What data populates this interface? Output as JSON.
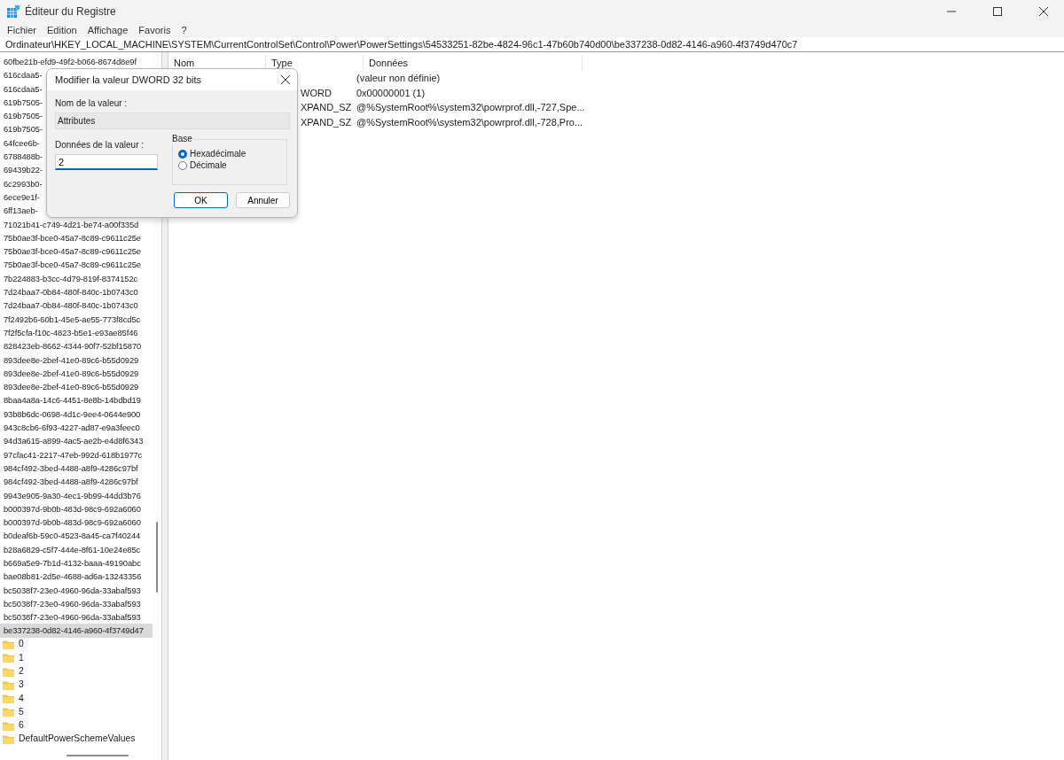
{
  "window": {
    "title": "Éditeur du Registre"
  },
  "menu": [
    "Fichier",
    "Edition",
    "Affichage",
    "Favoris",
    "?"
  ],
  "address": "Ordinateur\\HKEY_LOCAL_MACHINE\\SYSTEM\\CurrentControlSet\\Control\\Power\\PowerSettings\\54533251-82be-4824-96c1-47b60b740d00\\be337238-0d82-4146-a960-4f3749d470c7",
  "tree": [
    {
      "label": "60fbe21b-efd9-49f2-b066-8674d8e9f",
      "selected": false
    },
    {
      "label": "616cdaa5-",
      "selected": false
    },
    {
      "label": "616cdaa5-",
      "selected": false
    },
    {
      "label": "619b7505-",
      "selected": false
    },
    {
      "label": "619b7505-",
      "selected": false
    },
    {
      "label": "619b7505-",
      "selected": false
    },
    {
      "label": "64fcee6b-",
      "selected": false
    },
    {
      "label": "6788488b-",
      "selected": false
    },
    {
      "label": "69439b22-",
      "selected": false
    },
    {
      "label": "6c2993b0-",
      "selected": false
    },
    {
      "label": "6ece9e1f-",
      "selected": false
    },
    {
      "label": "6ff13aeb-",
      "selected": false
    },
    {
      "label": "71021b41-c749-4d21-be74-a00f335d",
      "selected": false
    },
    {
      "label": "75b0ae3f-bce0-45a7-8c89-c9611c25e",
      "selected": false
    },
    {
      "label": "75b0ae3f-bce0-45a7-8c89-c9611c25e",
      "selected": false
    },
    {
      "label": "75b0ae3f-bce0-45a7-8c89-c9611c25e",
      "selected": false
    },
    {
      "label": "7b224883-b3cc-4d79-819f-8374152c",
      "selected": false
    },
    {
      "label": "7d24baa7-0b84-480f-840c-1b0743c0",
      "selected": false
    },
    {
      "label": "7d24baa7-0b84-480f-840c-1b0743c0",
      "selected": false
    },
    {
      "label": "7f2492b6-60b1-45e5-ae55-773f8cd5c",
      "selected": false
    },
    {
      "label": "7f2f5cfa-f10c-4823-b5e1-e93ae85f46",
      "selected": false
    },
    {
      "label": "828423eb-8662-4344-90f7-52bf15870",
      "selected": false
    },
    {
      "label": "893dee8e-2bef-41e0-89c6-b55d0929",
      "selected": false
    },
    {
      "label": "893dee8e-2bef-41e0-89c6-b55d0929",
      "selected": false
    },
    {
      "label": "893dee8e-2bef-41e0-89c6-b55d0929",
      "selected": false
    },
    {
      "label": "8baa4a8a-14c6-4451-8e8b-14bdbd19",
      "selected": false
    },
    {
      "label": "93b8b6dc-0698-4d1c-9ee4-0644e900",
      "selected": false
    },
    {
      "label": "943c8cb6-6f93-4227-ad87-e9a3feec0",
      "selected": false
    },
    {
      "label": "94d3a615-a899-4ac5-ae2b-e4d8f6343",
      "selected": false
    },
    {
      "label": "97cfac41-2217-47eb-992d-618b1977c",
      "selected": false
    },
    {
      "label": "984cf492-3bed-4488-a8f9-4286c97bf",
      "selected": false
    },
    {
      "label": "984cf492-3bed-4488-a8f9-4286c97bf",
      "selected": false
    },
    {
      "label": "9943e905-9a30-4ec1-9b99-44dd3b76",
      "selected": false
    },
    {
      "label": "b000397d-9b0b-483d-98c9-692a6060",
      "selected": false
    },
    {
      "label": "b000397d-9b0b-483d-98c9-692a6060",
      "selected": false
    },
    {
      "label": "b0deaf6b-59c0-4523-8a45-ca7f40244",
      "selected": false
    },
    {
      "label": "b28a6829-c5f7-444e-8f61-10e24e85c",
      "selected": false
    },
    {
      "label": "b669a5e9-7b1d-4132-baaa-49190abc",
      "selected": false
    },
    {
      "label": "bae08b81-2d5e-4688-ad6a-13243356",
      "selected": false
    },
    {
      "label": "bc5038f7-23e0-4960-96da-33abaf593",
      "selected": false
    },
    {
      "label": "bc5038f7-23e0-4960-96da-33abaf593",
      "selected": false
    },
    {
      "label": "bc5038f7-23e0-4960-96da-33abaf593",
      "selected": false
    },
    {
      "label": "be337238-0d82-4146-a960-4f3749d47",
      "selected": true,
      "children": [
        {
          "label": "0",
          "selected": false
        },
        {
          "label": "1",
          "selected": false
        },
        {
          "label": "2",
          "selected": false
        },
        {
          "label": "3",
          "selected": false
        },
        {
          "label": "4",
          "selected": false
        },
        {
          "label": "5",
          "selected": false
        },
        {
          "label": "6",
          "selected": false
        },
        {
          "label": "DefaultPowerSchemeValues",
          "selected": false
        }
      ]
    }
  ],
  "values": {
    "columns": [
      "Nom",
      "Type",
      "Données"
    ],
    "rows": [
      {
        "type": "",
        "data": "(valeur non définie)"
      },
      {
        "type": "WORD",
        "data": "0x00000001 (1)"
      },
      {
        "type": "XPAND_SZ",
        "data": "@%SystemRoot%\\system32\\powrprof.dll,-727,Spe..."
      },
      {
        "type": "XPAND_SZ",
        "data": "@%SystemRoot%\\system32\\powrprof.dll,-728,Pro..."
      }
    ]
  },
  "dialog": {
    "title": "Modifier la valeur DWORD 32 bits",
    "name_label": "Nom de la valeur :",
    "name_value": "Attributes",
    "data_label": "Données de la valeur :",
    "data_value": "2",
    "base_label": "Base",
    "bases": [
      {
        "label": "Hexadécimale",
        "selected": true
      },
      {
        "label": "Décimale",
        "selected": false
      }
    ],
    "buttons": [
      {
        "label": "OK",
        "default": true
      },
      {
        "label": "Annuler",
        "default": false
      }
    ]
  }
}
